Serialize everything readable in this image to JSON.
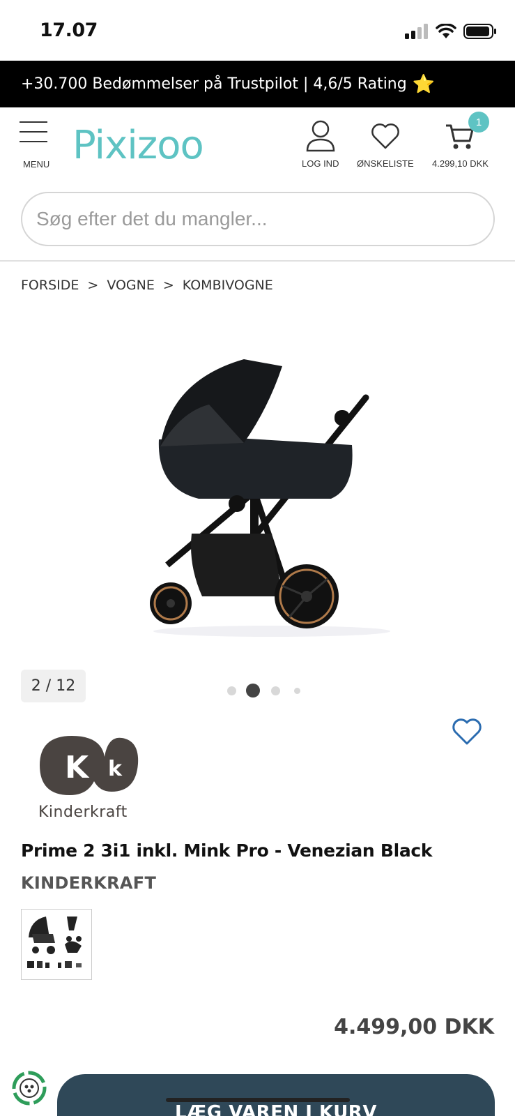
{
  "status_bar": {
    "time": "17.07"
  },
  "promo": {
    "text": "+30.700 Bedømmelser på Trustpilot | 4,6/5 Rating",
    "star": "⭐"
  },
  "header": {
    "menu_label": "MENU",
    "logo_text": "Pixizoo",
    "login_label": "LOG IND",
    "wishlist_label": "ØNSKELISTE",
    "cart_total": "4.299,10 DKK",
    "cart_count": "1"
  },
  "search": {
    "placeholder": "Søg efter det du mangler..."
  },
  "breadcrumb": {
    "items": [
      "FORSIDE",
      "VOGNE",
      "KOMBIVOGNE"
    ],
    "separator": ">"
  },
  "gallery": {
    "counter": "2 / 12",
    "dots": 4,
    "active_dot": 1
  },
  "product": {
    "brand_logo_text": "Kinderkraft",
    "title": "Prime 2 3i1 inkl. Mink Pro - Venezian Black",
    "brand": "KINDERKRAFT",
    "price": "4.499,00 DKK"
  },
  "actions": {
    "add_to_cart_label": "LÆG VAREN I KURV"
  },
  "colors": {
    "brand_teal": "#5ec3c3",
    "cart_button": "#2f4858",
    "heart_blue": "#2b6cb0"
  },
  "icons": [
    "menu-icon",
    "user-icon",
    "heart-icon",
    "cart-icon",
    "recycle-icon"
  ]
}
